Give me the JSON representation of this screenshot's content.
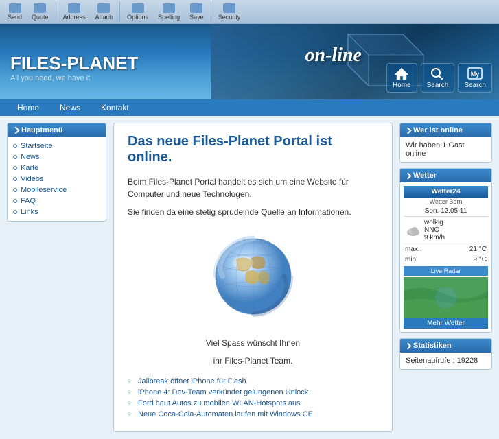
{
  "toolbar": {
    "buttons": [
      "Send",
      "Quote",
      "Address",
      "Attach",
      "Options",
      "Spelling",
      "Save",
      "Security"
    ]
  },
  "header": {
    "title": "FILES-PLANET",
    "subtitle": "All you need, we have it",
    "online_text": "on-line",
    "nav_icons": [
      {
        "label": "Home",
        "icon": "home-icon"
      },
      {
        "label": "Search",
        "icon": "search-icon"
      },
      {
        "label": "Search",
        "icon": "my-search-icon"
      }
    ]
  },
  "main_nav": {
    "items": [
      "Home",
      "News",
      "Kontakt"
    ]
  },
  "sidebar": {
    "title": "Hauptmenü",
    "items": [
      {
        "label": "Startseite",
        "href": "#"
      },
      {
        "label": "News",
        "href": "#"
      },
      {
        "label": "Karte",
        "href": "#"
      },
      {
        "label": "Videos",
        "href": "#"
      },
      {
        "label": "Mobileservice",
        "href": "#"
      },
      {
        "label": "FAQ",
        "href": "#"
      },
      {
        "label": "Links",
        "href": "#"
      }
    ]
  },
  "main": {
    "heading": "Das neue Files-Planet Portal ist online.",
    "paragraph1": "Beim Files-Planet Portal handelt es sich um eine Website für Computer und neue Technologen.",
    "paragraph2": "Sie finden da eine stetig sprudelnde Quelle an Informationen.",
    "sign_line1": "Viel Spass wünscht Ihnen",
    "sign_line2": "ihr Files-Planet Team.",
    "news_links": [
      "Jailbreak öffnet iPhone für Flash",
      "iPhone 4: Dev-Team verkündet gelungenen Unlock",
      "Ford baut Autos zu mobilen WLAN-Hotspots aus",
      "Neue Coca-Cola-Automaten laufen mit Windows CE"
    ]
  },
  "right_sidebar": {
    "online_box": {
      "title": "Wer ist online",
      "content": "Wir haben 1 Gast online"
    },
    "weather_box": {
      "title": "Wetter",
      "widget_title": "Wetter24",
      "sub": "Wetter Bern",
      "date": "Son. 12.05.11",
      "condition": "wolkig",
      "wind_dir": "NNO",
      "wind_speed": "9 km/h",
      "temp_max": "21 °C",
      "temp_min": "9 °C",
      "radar_label": "Live Radar",
      "more_label": "Mehr Wetter"
    },
    "stats_box": {
      "title": "Statistiken",
      "content": "Seitenaufrufe : 19228"
    }
  }
}
